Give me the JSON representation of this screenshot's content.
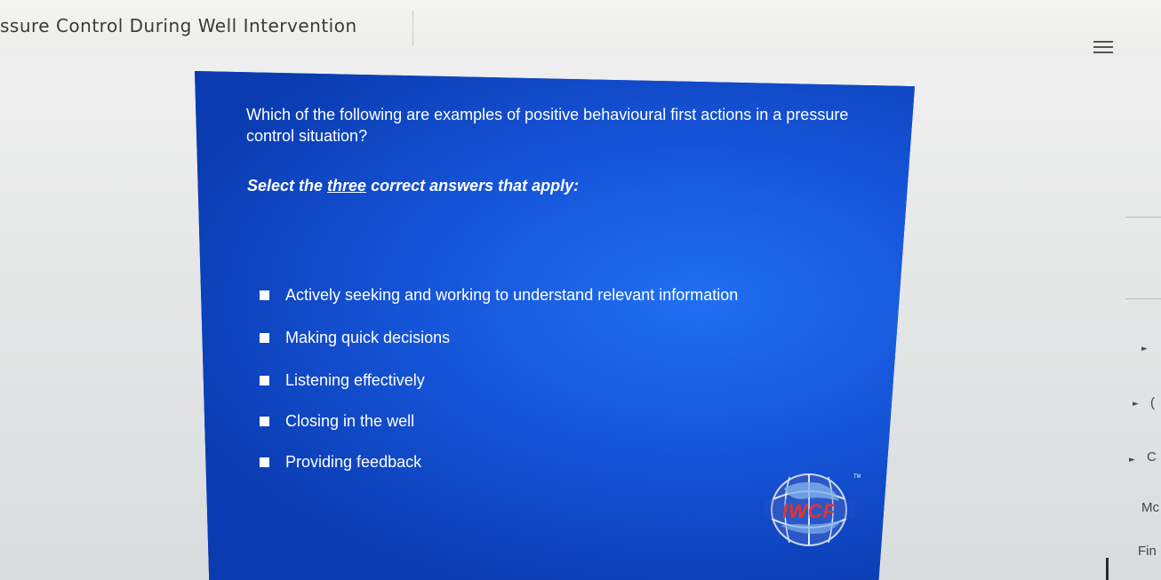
{
  "header": {
    "course_title": "ssure Control During Well Intervention",
    "menu_icon": "hamburger-menu-icon"
  },
  "slide": {
    "question": "Which of the following are examples of positive behavioural first actions in a pressure control situation?",
    "instruction_prefix": "Select the ",
    "instruction_emphasis": "three",
    "instruction_suffix": " correct answers that apply:",
    "options": [
      {
        "label": "Actively seeking and working to understand relevant information"
      },
      {
        "label": "Making quick decisions"
      },
      {
        "label": "Listening effectively"
      },
      {
        "label": "Closing in the well"
      },
      {
        "label": "Providing feedback"
      }
    ],
    "logo": {
      "text": "IWCF",
      "trademark": "TM"
    }
  },
  "sidebar_partial": {
    "items": [
      {
        "label": "",
        "icon": "chevron-right-icon"
      },
      {
        "label": "(",
        "icon": "chevron-right-icon"
      },
      {
        "label": "C",
        "icon": "chevron-right-icon"
      },
      {
        "label": "Mc",
        "icon": ""
      },
      {
        "label": "Fin",
        "icon": ""
      }
    ]
  },
  "colors": {
    "slide_blue": "#1554d8",
    "slide_highlight": "#1f6ff2",
    "logo_red": "#e3342f",
    "text_white": "#ffffff"
  }
}
